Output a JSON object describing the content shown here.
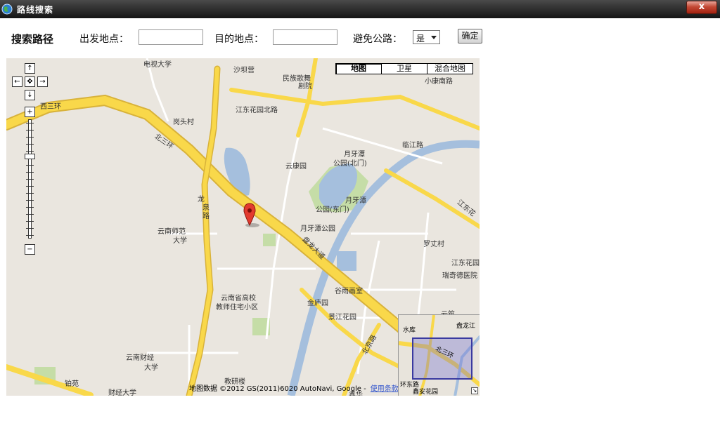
{
  "window": {
    "title": "路线搜索",
    "close_label": "x"
  },
  "toolbar": {
    "heading": "搜索路径",
    "origin_label": "出发地点：",
    "origin_value": "",
    "destination_label": "目的地点：",
    "destination_value": "",
    "avoid_label": "避免公路：",
    "avoid_selected": "是",
    "confirm_label": "确定"
  },
  "map": {
    "map_types": [
      "地图",
      "卫星",
      "混合地图"
    ],
    "active_map_type": "地图",
    "nav": {
      "up": "↑",
      "down": "↓",
      "left": "←",
      "right": "→",
      "center": "✥",
      "zoom_in": "+",
      "zoom_out": "−"
    },
    "labels": [
      "电视大学",
      "沙坝营",
      "民族歌舞",
      "剧院",
      "小康南路",
      "西三环",
      "江东花园北路",
      "岗头村",
      "北三环",
      "临江路",
      "月牙潭",
      "公园(北门)",
      "云康园",
      "龙",
      "泉",
      "路",
      "月牙潭",
      "公园(东门)",
      "江东花",
      "月牙潭公园",
      "云南师范",
      "大学",
      "罗丈村",
      "盘龙大道",
      "江东花园",
      "瑞奇德医院",
      "云南省高校",
      "教师住宅小区",
      "谷雨画室",
      "金庐园",
      "景江花园",
      "云南财经",
      "大学",
      "铂苑",
      "教研楼",
      "财经大学",
      "鑫华",
      "北京路",
      "云筑"
    ],
    "copyright": "地图数据 ©2012 GS(2011)6020 AutoNavi, Google -",
    "terms_link": "使用条款",
    "overview_labels": [
      "水库",
      "盘龙江",
      "北三环",
      "环东路",
      "鑫安花园"
    ]
  },
  "colors": {
    "road_major": "#f9d84a",
    "road_edge": "#d8b23a",
    "road_minor": "#ffffff",
    "water": "#a5bfdd",
    "park": "#c5dda7",
    "marker": "#e23b2e"
  }
}
